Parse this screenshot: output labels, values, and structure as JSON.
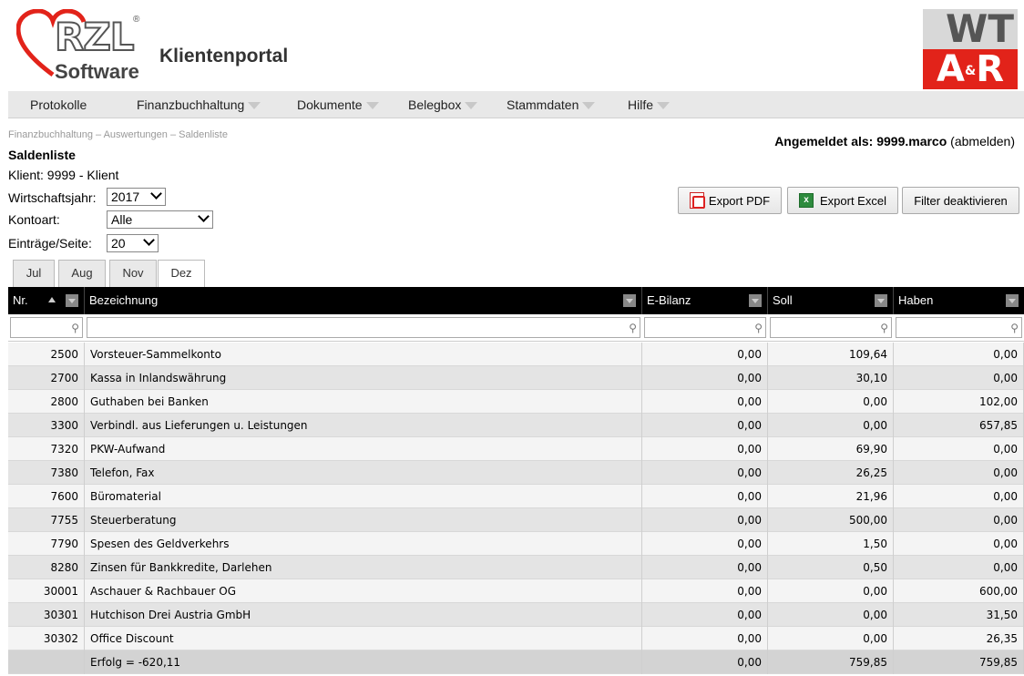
{
  "header": {
    "logo_main": "RZL",
    "logo_reg": "®",
    "logo_sub": "Software",
    "app_title": "Klientenportal",
    "partner_top": "WT",
    "partner_bottom_a": "A",
    "partner_bottom_amp": "&",
    "partner_bottom_r": "R"
  },
  "nav": {
    "items": [
      {
        "label": "Protokolle",
        "has_menu": false
      },
      {
        "label": "Finanzbuchhaltung",
        "has_menu": true
      },
      {
        "label": "Dokumente",
        "has_menu": true
      },
      {
        "label": "Belegbox",
        "has_menu": true
      },
      {
        "label": "Stammdaten",
        "has_menu": true
      },
      {
        "label": "Hilfe",
        "has_menu": true
      }
    ]
  },
  "breadcrumb": "Finanzbuchhaltung – Auswertungen – Saldenliste",
  "login": {
    "prefix": "Angemeldet als: 9999.marco",
    "logout": "(abmelden)"
  },
  "page_title": "Saldenliste",
  "client_line": "Klient:  9999 - Klient",
  "filters": {
    "year_label": "Wirtschaftsjahr:",
    "year_value": "2017",
    "kontoart_label": "Kontoart:",
    "kontoart_value": "Alle",
    "entries_label": "Einträge/Seite:",
    "entries_value": "20"
  },
  "buttons": {
    "export_pdf": "Export PDF",
    "export_excel": "Export Excel",
    "filter_off": "Filter deaktivieren"
  },
  "tabs": [
    {
      "label": "Jul",
      "active": false
    },
    {
      "label": "Aug",
      "active": false
    },
    {
      "label": "Nov",
      "active": false
    },
    {
      "label": "Dez",
      "active": true
    }
  ],
  "grid": {
    "columns": [
      "Nr.",
      "Bezeichnung",
      "E-Bilanz",
      "Soll",
      "Haben"
    ],
    "rows": [
      {
        "nr": "2500",
        "bez": "Vorsteuer-Sammelkonto",
        "ebilanz": "0,00",
        "soll": "109,64",
        "haben": "0,00"
      },
      {
        "nr": "2700",
        "bez": "Kassa in Inlandswährung",
        "ebilanz": "0,00",
        "soll": "30,10",
        "haben": "0,00"
      },
      {
        "nr": "2800",
        "bez": "Guthaben bei Banken",
        "ebilanz": "0,00",
        "soll": "0,00",
        "haben": "102,00"
      },
      {
        "nr": "3300",
        "bez": "Verbindl. aus Lieferungen u. Leistungen",
        "ebilanz": "0,00",
        "soll": "0,00",
        "haben": "657,85"
      },
      {
        "nr": "7320",
        "bez": "PKW-Aufwand",
        "ebilanz": "0,00",
        "soll": "69,90",
        "haben": "0,00"
      },
      {
        "nr": "7380",
        "bez": "Telefon, Fax",
        "ebilanz": "0,00",
        "soll": "26,25",
        "haben": "0,00"
      },
      {
        "nr": "7600",
        "bez": "Büromaterial",
        "ebilanz": "0,00",
        "soll": "21,96",
        "haben": "0,00"
      },
      {
        "nr": "7755",
        "bez": "Steuerberatung",
        "ebilanz": "0,00",
        "soll": "500,00",
        "haben": "0,00"
      },
      {
        "nr": "7790",
        "bez": "Spesen des Geldverkehrs",
        "ebilanz": "0,00",
        "soll": "1,50",
        "haben": "0,00"
      },
      {
        "nr": "8280",
        "bez": "Zinsen für Bankkredite, Darlehen",
        "ebilanz": "0,00",
        "soll": "0,50",
        "haben": "0,00"
      },
      {
        "nr": "30001",
        "bez": "Aschauer & Rachbauer OG",
        "ebilanz": "0,00",
        "soll": "0,00",
        "haben": "600,00"
      },
      {
        "nr": "30301",
        "bez": "Hutchison Drei Austria GmbH",
        "ebilanz": "0,00",
        "soll": "0,00",
        "haben": "31,50"
      },
      {
        "nr": "30302",
        "bez": "Office Discount",
        "ebilanz": "0,00",
        "soll": "0,00",
        "haben": "26,35"
      }
    ],
    "total": {
      "nr": "",
      "bez": "Erfolg = -620,11",
      "ebilanz": "0,00",
      "soll": "759,85",
      "haben": "759,85"
    }
  },
  "colors": {
    "brand_red": "#e2231a",
    "nav_bg": "#e8e8e8",
    "grid_header": "#000000"
  }
}
